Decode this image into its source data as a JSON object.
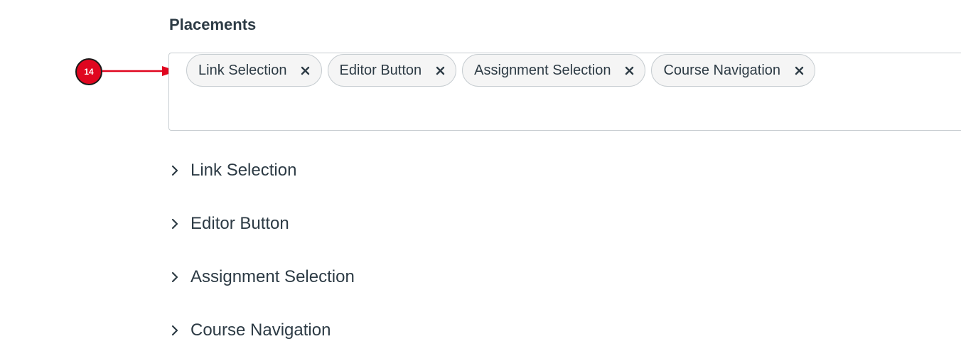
{
  "section": {
    "title": "Placements"
  },
  "callout": {
    "number": "14",
    "color": "#e0061f"
  },
  "selected_placements": [
    {
      "label": "Link Selection",
      "remove_icon": "close-icon"
    },
    {
      "label": "Editor Button",
      "remove_icon": "close-icon"
    },
    {
      "label": "Assignment Selection",
      "remove_icon": "close-icon"
    },
    {
      "label": "Course Navigation",
      "remove_icon": "close-icon"
    }
  ],
  "accordion": [
    {
      "label": "Link Selection",
      "icon": "chevron-right-icon"
    },
    {
      "label": "Editor Button",
      "icon": "chevron-right-icon"
    },
    {
      "label": "Assignment Selection",
      "icon": "chevron-right-icon"
    },
    {
      "label": "Course Navigation",
      "icon": "chevron-right-icon"
    }
  ]
}
